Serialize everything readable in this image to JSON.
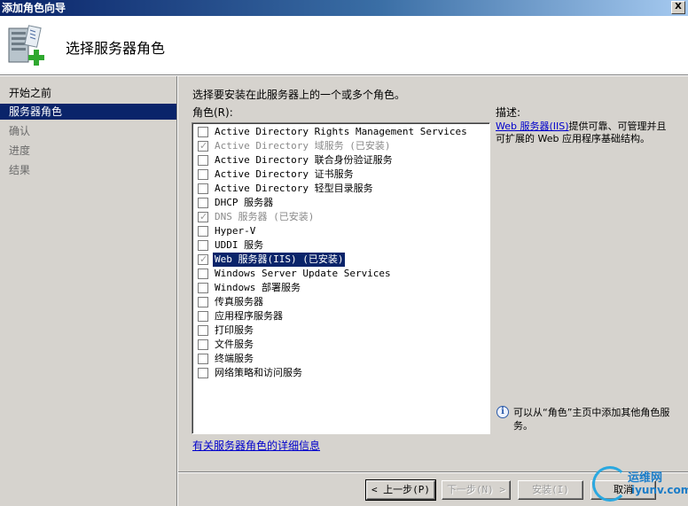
{
  "window": {
    "title": "添加角色向导",
    "close_label": "X"
  },
  "header": {
    "title": "选择服务器角色"
  },
  "sidebar": {
    "items": [
      {
        "label": "开始之前",
        "state": "normal"
      },
      {
        "label": "服务器角色",
        "state": "active"
      },
      {
        "label": "确认",
        "state": "dim"
      },
      {
        "label": "进度",
        "state": "dim"
      },
      {
        "label": "结果",
        "state": "dim"
      }
    ]
  },
  "main": {
    "instruction": "选择要安装在此服务器上的一个或多个角色。",
    "roles_label": "角色(R):",
    "roles": [
      {
        "label": "Active Directory Rights Management Services",
        "checked": false,
        "installed": false,
        "selected": false
      },
      {
        "label": "Active Directory 域服务  (已安装)",
        "checked": true,
        "installed": true,
        "selected": false
      },
      {
        "label": "Active Directory 联合身份验证服务",
        "checked": false,
        "installed": false,
        "selected": false
      },
      {
        "label": "Active Directory 证书服务",
        "checked": false,
        "installed": false,
        "selected": false
      },
      {
        "label": "Active Directory 轻型目录服务",
        "checked": false,
        "installed": false,
        "selected": false
      },
      {
        "label": "DHCP 服务器",
        "checked": false,
        "installed": false,
        "selected": false
      },
      {
        "label": "DNS 服务器  (已安装)",
        "checked": true,
        "installed": true,
        "selected": false
      },
      {
        "label": "Hyper-V",
        "checked": false,
        "installed": false,
        "selected": false
      },
      {
        "label": "UDDI 服务",
        "checked": false,
        "installed": false,
        "selected": false
      },
      {
        "label": "Web 服务器(IIS)  (已安装)",
        "checked": true,
        "installed": true,
        "selected": true
      },
      {
        "label": "Windows Server Update Services",
        "checked": false,
        "installed": false,
        "selected": false
      },
      {
        "label": "Windows 部署服务",
        "checked": false,
        "installed": false,
        "selected": false
      },
      {
        "label": "传真服务器",
        "checked": false,
        "installed": false,
        "selected": false
      },
      {
        "label": "应用程序服务器",
        "checked": false,
        "installed": false,
        "selected": false
      },
      {
        "label": "打印服务",
        "checked": false,
        "installed": false,
        "selected": false
      },
      {
        "label": "文件服务",
        "checked": false,
        "installed": false,
        "selected": false
      },
      {
        "label": "终端服务",
        "checked": false,
        "installed": false,
        "selected": false
      },
      {
        "label": "网络策略和访问服务",
        "checked": false,
        "installed": false,
        "selected": false
      }
    ],
    "description_title": "描述:",
    "description_link": "Web 服务器(IIS)",
    "description_text": "提供可靠、可管理并且可扩展的 Web 应用程序基础结构。",
    "info_text": "可以从“角色”主页中添加其他角色服务。",
    "more_info_link": "有关服务器角色的详细信息"
  },
  "buttons": {
    "back": "< 上一步(P)",
    "next": "下一步(N) >",
    "install": "安装(I)",
    "cancel": "取消"
  },
  "watermark": {
    "text": "运维网",
    "sub": "iyunv.com"
  }
}
